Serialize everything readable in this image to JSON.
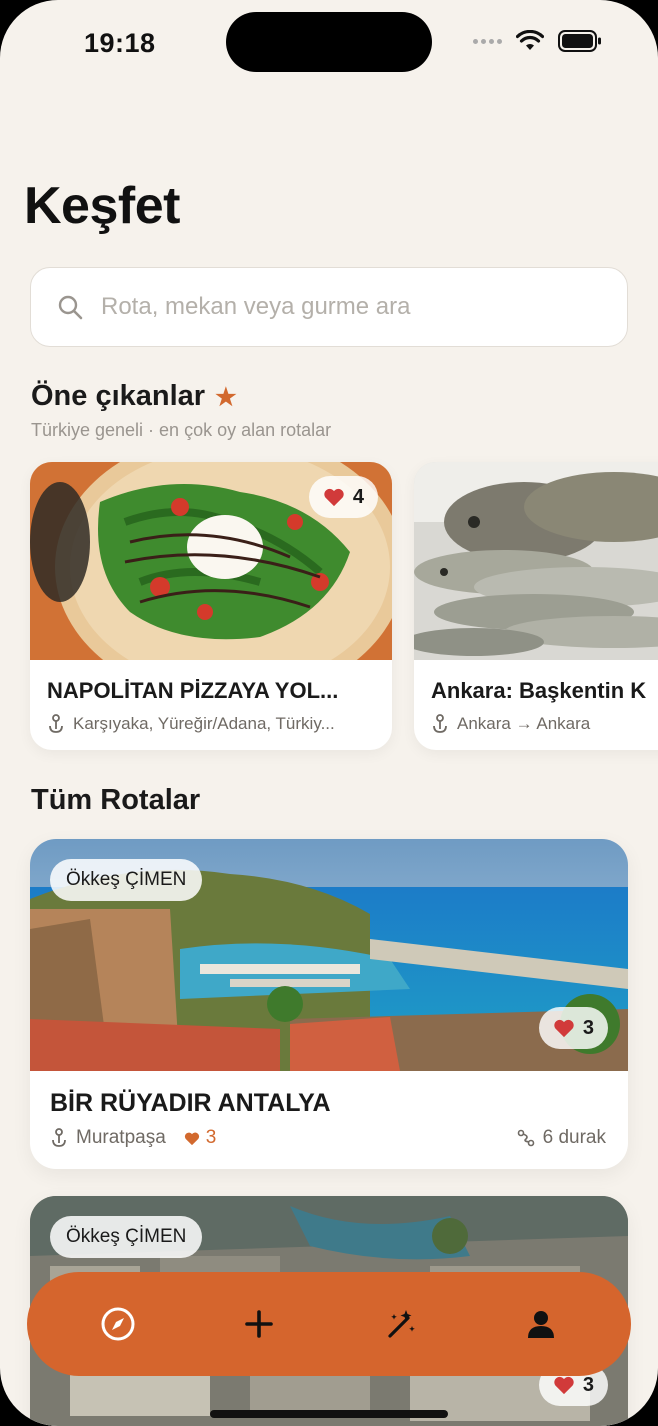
{
  "status": {
    "time": "19:18"
  },
  "page": {
    "title": "Keşfet"
  },
  "search": {
    "placeholder": "Rota, mekan veya gurme ara",
    "value": ""
  },
  "featured": {
    "title": "Öne çıkanlar",
    "subtitle": "Türkiye geneli · en çok oy alan rotalar",
    "cards": [
      {
        "title": "NAPOLİTAN PİZZAYA YOL...",
        "location": "Karşıyaka, Yüreğir/Adana, Türkiy...",
        "likes": "4"
      },
      {
        "title": "Ankara: Başkentin K",
        "location": "Ankara → Ankara"
      }
    ]
  },
  "all_routes": {
    "title": "Tüm Rotalar",
    "items": [
      {
        "author": "Ökkeş ÇİMEN",
        "likes_badge": "3",
        "title": "BİR RÜYADIR ANTALYA",
        "location": "Muratpaşa",
        "likes": "3",
        "stops": "6 durak"
      },
      {
        "author": "Ökkeş ÇİMEN",
        "likes_badge": "3"
      }
    ]
  },
  "tabbar": {
    "tabs": [
      "compass-icon",
      "plus-icon",
      "magic-wand-icon",
      "person-icon"
    ]
  },
  "colors": {
    "accent": "#d5652d",
    "background": "#f6f2ec",
    "heart": "#d13a3a"
  }
}
